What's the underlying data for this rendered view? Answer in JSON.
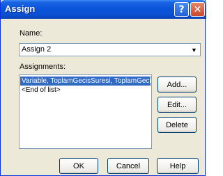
{
  "window": {
    "title": "Assign"
  },
  "titlebar": {
    "help_glyph": "?",
    "close_glyph": "✕"
  },
  "name_field": {
    "label": "Name:",
    "value": "Assign 2",
    "arrow": "▼"
  },
  "assignments": {
    "label": "Assignments:",
    "items": [
      {
        "text": "Variable, ToplamGecisSuresi, ToplamGecis",
        "selected": true
      },
      {
        "text": "<End of list>",
        "selected": false
      }
    ]
  },
  "side_buttons": {
    "add": "Add...",
    "edit": "Edit...",
    "delete": "Delete"
  },
  "bottom_buttons": {
    "ok": "OK",
    "cancel": "Cancel",
    "help": "Help"
  },
  "colors": {
    "titlebar": "#0a55dc",
    "selection": "#316ac5",
    "dialog_bg": "#ece9d8"
  },
  "icons": {
    "help": "help-icon",
    "close": "close-icon",
    "dropdown": "chevron-down-icon"
  }
}
